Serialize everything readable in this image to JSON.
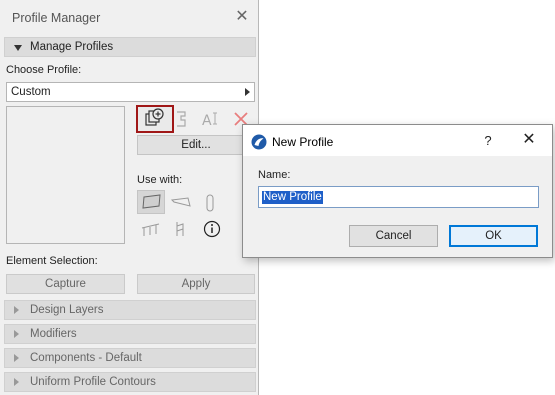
{
  "profile_manager": {
    "title": "Profile Manager",
    "sections": {
      "manage_profiles": "Manage Profiles",
      "design_layers": "Design Layers",
      "modifiers": "Modifiers",
      "components": "Components - Default",
      "uniform_contours": "Uniform Profile Contours"
    },
    "choose_profile_label": "Choose Profile:",
    "selected_profile": "Custom",
    "toolbar_icons": [
      "new-profile-icon",
      "duplicate-icon",
      "rename-icon",
      "delete-icon"
    ],
    "edit_label": "Edit...",
    "use_with_label": "Use with:",
    "use_with_icons": [
      "wall-icon",
      "beam-icon",
      "column-icon",
      "railing-icon",
      "handrail-icon",
      "info-icon"
    ],
    "element_selection_label": "Element Selection:",
    "capture_label": "Capture",
    "apply_label": "Apply"
  },
  "new_profile_dialog": {
    "title": "New Profile",
    "help_glyph": "?",
    "name_label": "Name:",
    "name_value": "New Profile",
    "cancel_label": "Cancel",
    "ok_label": "OK"
  },
  "colors": {
    "highlight_border": "#a01717",
    "ok_border": "#0078d7",
    "text_selection": "#1e5fc8",
    "delete_icon": "#e87d7d"
  }
}
